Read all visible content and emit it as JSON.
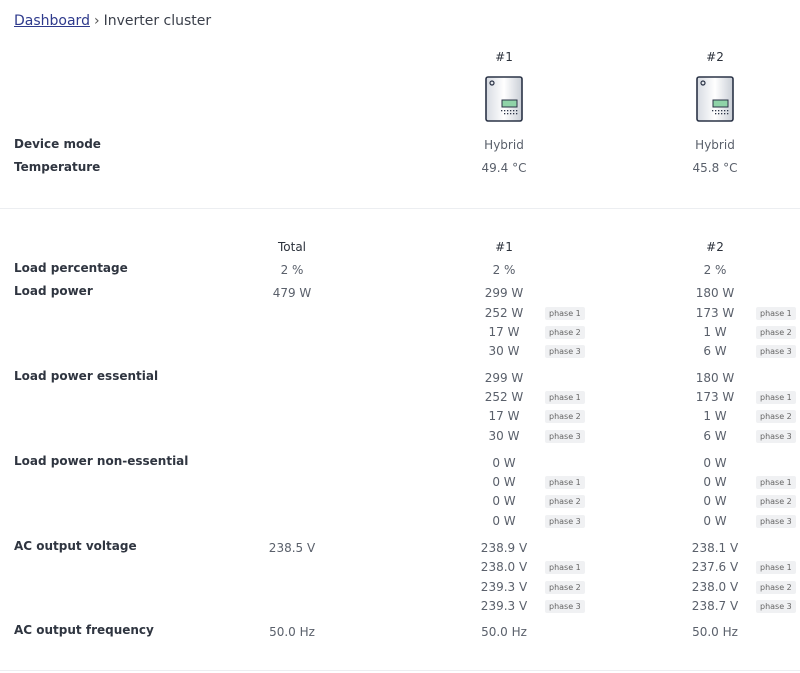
{
  "breadcrumb": {
    "root": "Dashboard",
    "separator": "›",
    "current": "Inverter cluster"
  },
  "top": {
    "inverters": [
      {
        "label": "#1",
        "mode": "Hybrid",
        "temperature": "49.4 °C"
      },
      {
        "label": "#2",
        "mode": "Hybrid",
        "temperature": "45.8 °C"
      }
    ],
    "rows": {
      "device_mode": "Device mode",
      "temperature": "Temperature"
    }
  },
  "table": {
    "headers": {
      "total": "Total",
      "inv1": "#1",
      "inv2": "#2"
    },
    "phase_labels": [
      "phase 1",
      "phase 2",
      "phase 3"
    ],
    "load_percentage": {
      "label": "Load percentage",
      "total": "2 %",
      "inv1": "2 %",
      "inv2": "2 %"
    },
    "load_power": {
      "label": "Load power",
      "total": "479 W",
      "inv1": [
        "299 W",
        "252 W",
        "17 W",
        "30 W"
      ],
      "inv2": [
        "180 W",
        "173 W",
        "1 W",
        "6 W"
      ]
    },
    "load_power_essential": {
      "label": "Load power essential",
      "inv1": [
        "299 W",
        "252 W",
        "17 W",
        "30 W"
      ],
      "inv2": [
        "180 W",
        "173 W",
        "1 W",
        "6 W"
      ]
    },
    "load_power_nonessential": {
      "label": "Load power non-essential",
      "inv1": [
        "0 W",
        "0 W",
        "0 W",
        "0 W"
      ],
      "inv2": [
        "0 W",
        "0 W",
        "0 W",
        "0 W"
      ]
    },
    "ac_output_voltage": {
      "label": "AC output voltage",
      "total": "238.5 V",
      "inv1": [
        "238.9 V",
        "238.0 V",
        "239.3 V",
        "239.3 V"
      ],
      "inv2": [
        "238.1 V",
        "237.6 V",
        "238.0 V",
        "238.7 V"
      ]
    },
    "ac_output_frequency": {
      "label": "AC output frequency",
      "total": "50.0 Hz",
      "inv1": "50.0 Hz",
      "inv2": "50.0 Hz"
    }
  },
  "colors": {
    "link": "#2e3a8c",
    "divider": "#eceef1",
    "phase_bg": "#f0f1f3",
    "inverter_screen": "#8fd3a8"
  },
  "icons": {
    "inverter": "inverter-device-icon"
  }
}
